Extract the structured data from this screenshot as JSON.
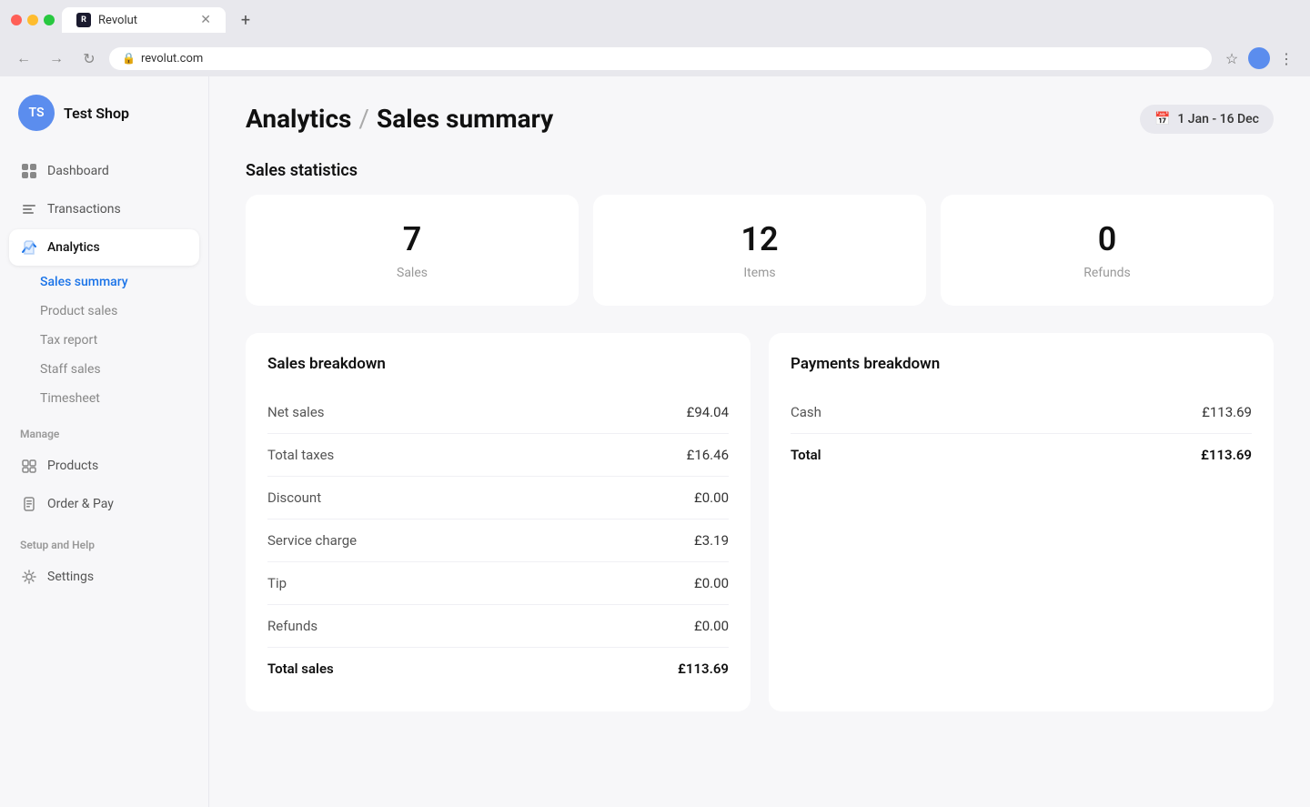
{
  "browser": {
    "tab_title": "Revolut",
    "tab_favicon": "R",
    "url": "revolut.com",
    "new_tab_label": "+"
  },
  "shop": {
    "initials": "TS",
    "name": "Test Shop"
  },
  "nav": {
    "items": [
      {
        "id": "dashboard",
        "label": "Dashboard",
        "icon": "dashboard"
      },
      {
        "id": "transactions",
        "label": "Transactions",
        "icon": "transactions"
      },
      {
        "id": "analytics",
        "label": "Analytics",
        "icon": "analytics",
        "active": true
      }
    ],
    "analytics_subitems": [
      {
        "id": "sales-summary",
        "label": "Sales summary",
        "active": true
      },
      {
        "id": "product-sales",
        "label": "Product sales"
      },
      {
        "id": "tax-report",
        "label": "Tax report"
      },
      {
        "id": "staff-sales",
        "label": "Staff sales"
      },
      {
        "id": "timesheet",
        "label": "Timesheet"
      }
    ],
    "manage_section": "Manage",
    "manage_items": [
      {
        "id": "products",
        "label": "Products",
        "icon": "products"
      },
      {
        "id": "order-pay",
        "label": "Order & Pay",
        "icon": "order-pay"
      }
    ],
    "setup_section": "Setup and Help",
    "setup_items": [
      {
        "id": "settings",
        "label": "Settings",
        "icon": "settings"
      }
    ]
  },
  "page": {
    "title": "Analytics",
    "breadcrumb_sep": "/",
    "subtitle": "Sales summary",
    "date_range": "1 Jan - 16 Dec"
  },
  "stats": {
    "section_title": "Sales statistics",
    "cards": [
      {
        "value": "7",
        "label": "Sales"
      },
      {
        "value": "12",
        "label": "Items"
      },
      {
        "value": "0",
        "label": "Refunds"
      }
    ]
  },
  "sales_breakdown": {
    "title": "Sales breakdown",
    "rows": [
      {
        "label": "Net sales",
        "value": "£94.04"
      },
      {
        "label": "Total taxes",
        "value": "£16.46"
      },
      {
        "label": "Discount",
        "value": "£0.00"
      },
      {
        "label": "Service charge",
        "value": "£3.19"
      },
      {
        "label": "Tip",
        "value": "£0.00"
      },
      {
        "label": "Refunds",
        "value": "£0.00"
      }
    ],
    "total_label": "Total sales",
    "total_value": "£113.69"
  },
  "payments_breakdown": {
    "title": "Payments breakdown",
    "rows": [
      {
        "label": "Cash",
        "value": "£113.69"
      }
    ],
    "total_label": "Total",
    "total_value": "£113.69"
  }
}
